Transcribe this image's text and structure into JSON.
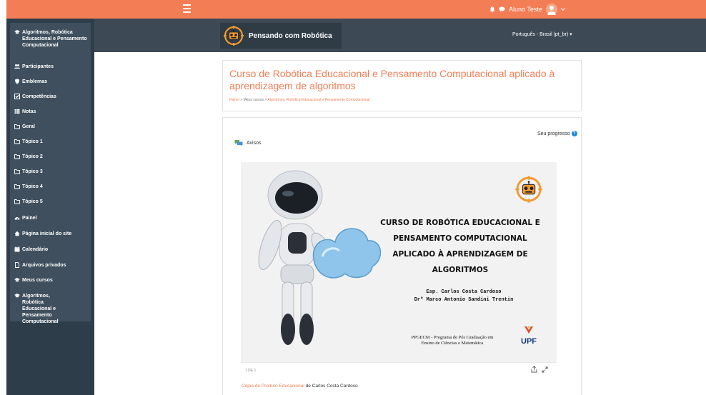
{
  "topbar": {
    "user_name": "Aluno Teste",
    "colors": {
      "accent": "#f37d55",
      "sidebar": "#2d3d4a",
      "header": "#3d4a55"
    }
  },
  "sidebar": {
    "items": [
      {
        "label": "Algoritmos, Robótica Educacional e Pensamento Computacional",
        "icon": "graduation-cap-icon"
      },
      {
        "label": "Participantes",
        "icon": "users-icon"
      },
      {
        "label": "Emblemas",
        "icon": "shield-icon"
      },
      {
        "label": "Competências",
        "icon": "check-square-icon"
      },
      {
        "label": "Notas",
        "icon": "table-icon"
      },
      {
        "label": "Geral",
        "icon": "folder-icon"
      },
      {
        "label": "Tópico 1",
        "icon": "folder-icon"
      },
      {
        "label": "Tópico 2",
        "icon": "folder-icon"
      },
      {
        "label": "Tópico 3",
        "icon": "folder-icon"
      },
      {
        "label": "Tópico 4",
        "icon": "folder-icon"
      },
      {
        "label": "Tópico 5",
        "icon": "folder-icon"
      },
      {
        "label": "Painel",
        "icon": "dashboard-icon"
      },
      {
        "label": "Página inicial do site",
        "icon": "home-icon"
      },
      {
        "label": "Calendário",
        "icon": "calendar-icon"
      },
      {
        "label": "Arquivos privados",
        "icon": "file-icon"
      },
      {
        "label": "Meus cursos",
        "icon": "graduation-cap-icon"
      },
      {
        "label": "Algoritmos, Robótica Educacional e Pensamento Computacional",
        "icon": "graduation-cap-icon"
      }
    ]
  },
  "header": {
    "site_title": "Pensando com Robótica",
    "language": "Português - Brasil (pt_br)"
  },
  "course": {
    "title": "Curso de Robótica Educacional e Pensamento Computacional aplicado à aprendizagem de algoritmos",
    "breadcrumb": [
      "Painel",
      "Meus cursos",
      "Algoritmos, Robótica Educacional e Pensamento Computacional"
    ],
    "breadcrumb_sep": ">"
  },
  "content": {
    "progress_label": "Seu progresso",
    "forum_label": "Avisos",
    "slide": {
      "title_lines": [
        "CURSO DE ROBÓTICA EDUCACIONAL E",
        "PENSAMENTO COMPUTACIONAL",
        "APLICADO À APRENDIZAGEM DE",
        "ALGORITMOS"
      ],
      "author1": "Esp. Carlos Costa Cardoso",
      "author2": "Drº Marco Antonio Sandini Trentin",
      "program_line1": "PPGECM - Programa de Pós Graduação em",
      "program_line2": "Ensino de Ciências e Matemática",
      "logo_text": "UPF",
      "page_indicator": "1 DE 1"
    },
    "credit_link": "Cópia de Produto Educacional",
    "credit_rest": " de Carlos Costa Cardoso"
  }
}
